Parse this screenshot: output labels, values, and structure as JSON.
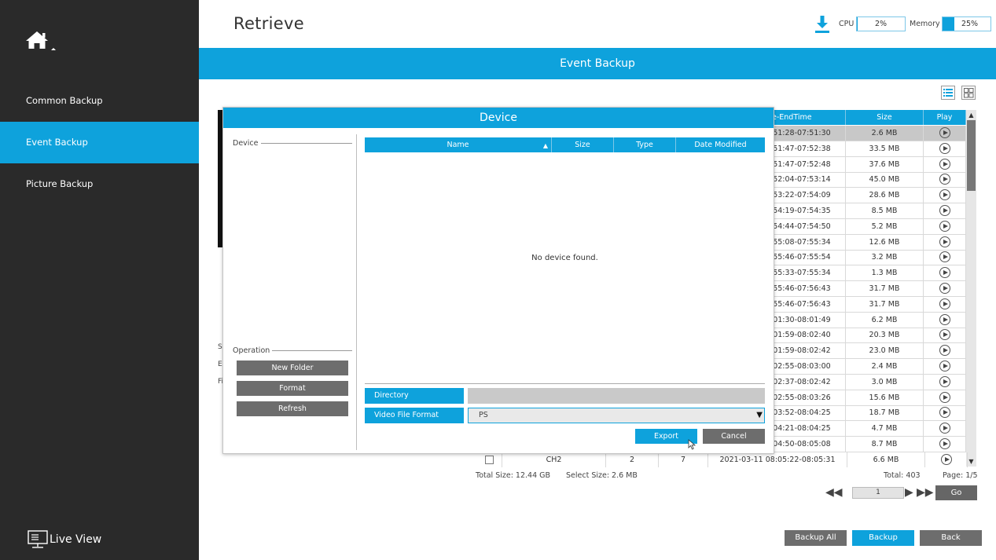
{
  "sidebar": {
    "items": [
      {
        "label": "Common Backup"
      },
      {
        "label": "Event Backup"
      },
      {
        "label": "Picture Backup"
      }
    ],
    "live_view": "Live View"
  },
  "header": {
    "title": "Retrieve",
    "cpu_label": "CPU",
    "cpu_value": "2%",
    "cpu_level": 2,
    "memory_label": "Memory",
    "memory_value": "25%",
    "memory_level": 25,
    "section_title": "Event Backup"
  },
  "table": {
    "columns": [
      "e-EndTime",
      "Size",
      "Play"
    ],
    "rows": [
      {
        "time": ":51:28-07:51:30",
        "size": "2.6 MB"
      },
      {
        "time": ":51:47-07:52:38",
        "size": "33.5 MB"
      },
      {
        "time": ":51:47-07:52:48",
        "size": "37.6 MB"
      },
      {
        "time": ":52:04-07:53:14",
        "size": "45.0 MB"
      },
      {
        "time": ":53:22-07:54:09",
        "size": "28.6 MB"
      },
      {
        "time": ":54:19-07:54:35",
        "size": "8.5 MB"
      },
      {
        "time": ":54:44-07:54:50",
        "size": "5.2 MB"
      },
      {
        "time": ":55:08-07:55:34",
        "size": "12.6 MB"
      },
      {
        "time": ":55:46-07:55:54",
        "size": "3.2 MB"
      },
      {
        "time": ":55:33-07:55:34",
        "size": "1.3 MB"
      },
      {
        "time": ":55:46-07:56:43",
        "size": "31.7 MB"
      },
      {
        "time": ":55:46-07:56:43",
        "size": "31.7 MB"
      },
      {
        "time": ":01:30-08:01:49",
        "size": "6.2 MB"
      },
      {
        "time": ":01:59-08:02:40",
        "size": "20.3 MB"
      },
      {
        "time": ":01:59-08:02:42",
        "size": "23.0 MB"
      },
      {
        "time": ":02:55-08:03:00",
        "size": "2.4 MB"
      },
      {
        "time": ":02:37-08:02:42",
        "size": "3.0 MB"
      },
      {
        "time": ":02:55-08:03:26",
        "size": "15.6 MB"
      },
      {
        "time": ":03:52-08:04:25",
        "size": "18.7 MB"
      },
      {
        "time": ":04:21-08:04:25",
        "size": "4.7 MB"
      },
      {
        "time": ":04:50-08:05:08",
        "size": "8.7 MB"
      }
    ],
    "last_row": {
      "channel": "CH2",
      "c3": "2",
      "c4": "7",
      "time": "2021-03-11 08:05:22-08:05:31",
      "size": "6.6 MB"
    }
  },
  "footer": {
    "total_size": "Total Size: 12.44 GB",
    "select_size": "Select Size: 2.6 MB",
    "total": "Total: 403",
    "page": "Page: 1/5",
    "page_input": "1",
    "go": "Go",
    "backup_all": "Backup All",
    "backup": "Backup",
    "back": "Back"
  },
  "background_labels": [
    "S",
    "E",
    "Fi"
  ],
  "dialog": {
    "title": "Device",
    "device_group": "Device",
    "operation_group": "Operation",
    "buttons": {
      "new_folder": "New Folder",
      "format": "Format",
      "refresh": "Refresh",
      "export": "Export",
      "cancel": "Cancel"
    },
    "columns": [
      "Name",
      "Size",
      "Type",
      "Date Modified"
    ],
    "empty_message": "No device found.",
    "directory_label": "Directory",
    "directory_value": "",
    "format_label": "Video File Format",
    "format_value": "PS"
  },
  "colors": {
    "accent": "#0ea2dc",
    "sidebar": "#2a2a2a",
    "button_gray": "#6d6d6d"
  }
}
